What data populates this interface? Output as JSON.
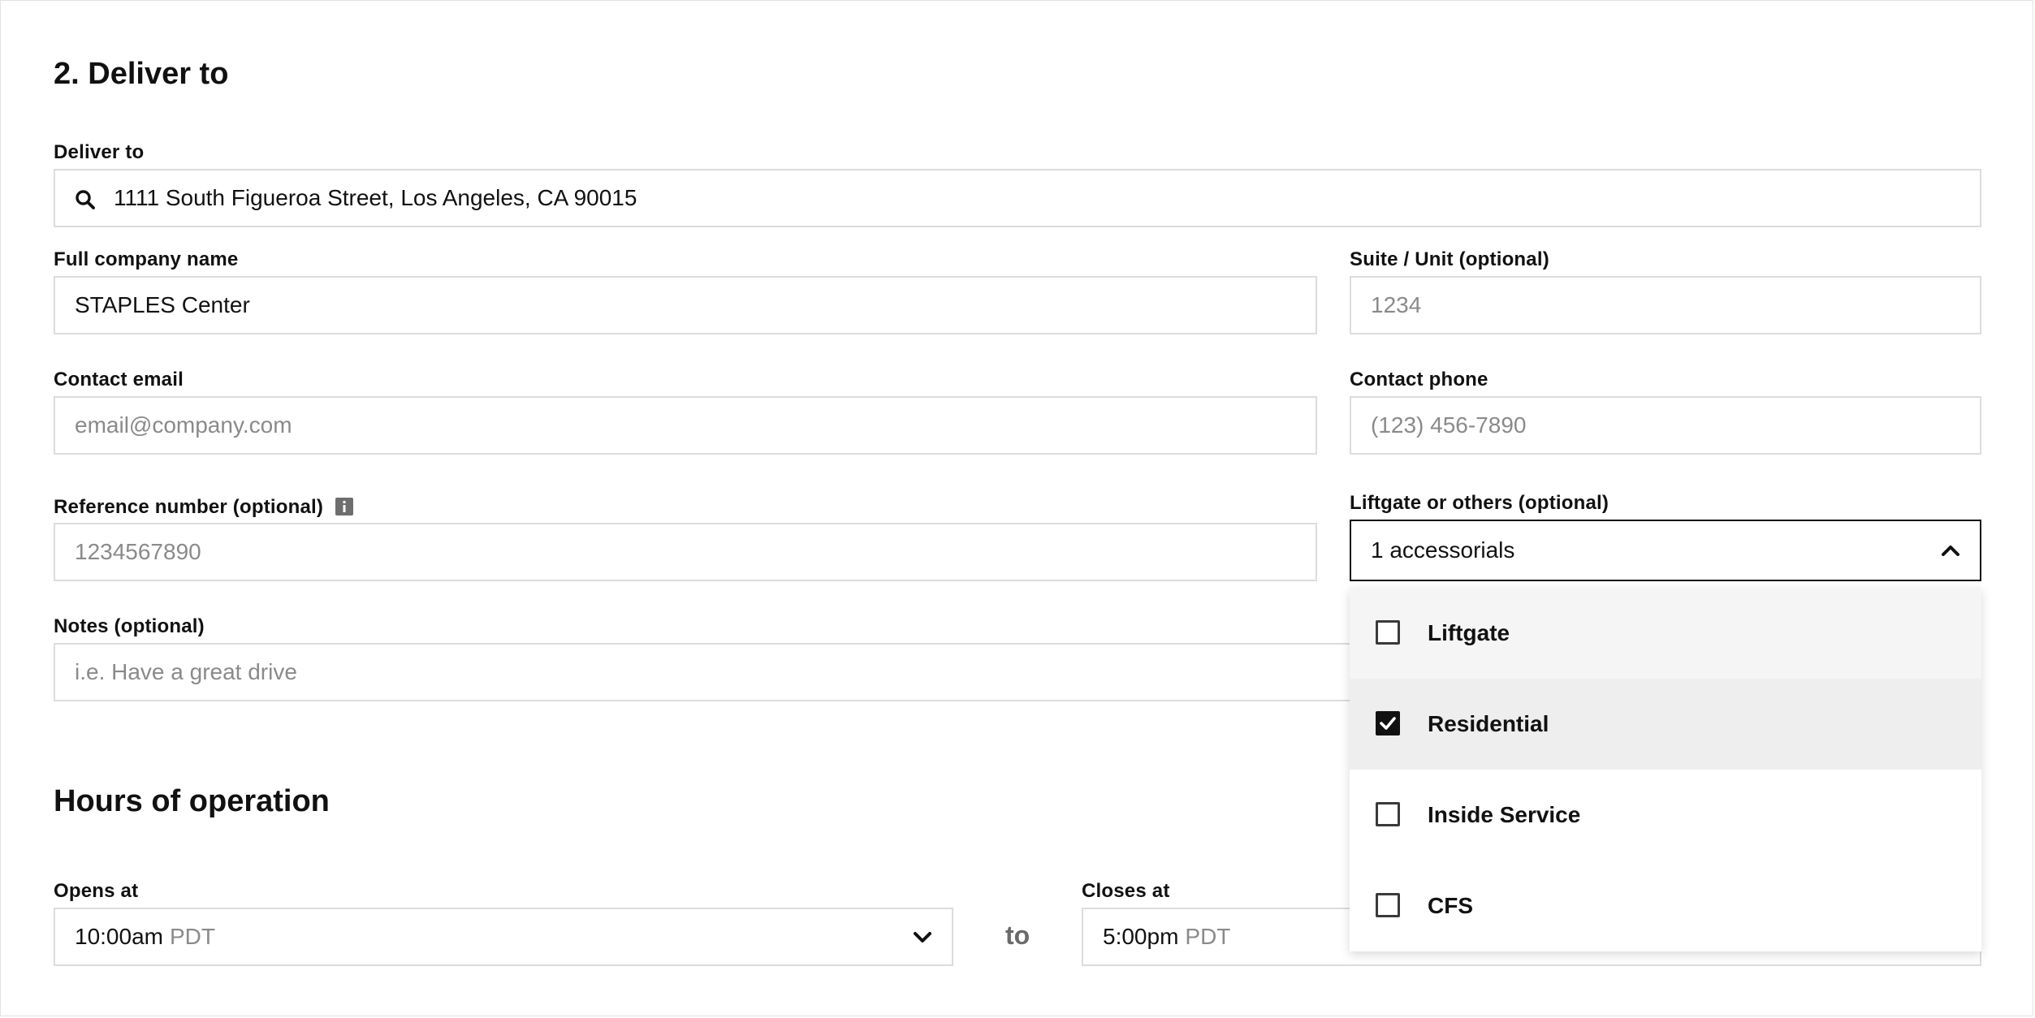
{
  "section": {
    "title": "2. Deliver to"
  },
  "deliver_to": {
    "label": "Deliver to",
    "value": "1111 South Figueroa Street, Los Angeles, CA 90015",
    "icon": "search-icon"
  },
  "company": {
    "label": "Full company name",
    "value": "STAPLES Center"
  },
  "suite": {
    "label": "Suite / Unit (optional)",
    "placeholder": "1234"
  },
  "email": {
    "label": "Contact email",
    "placeholder": "email@company.com"
  },
  "phone": {
    "label": "Contact phone",
    "placeholder": "(123) 456-7890"
  },
  "reference": {
    "label": "Reference number (optional)",
    "placeholder": "1234567890",
    "icon": "info-icon"
  },
  "accessorials": {
    "label": "Liftgate or others (optional)",
    "value": "1 accessorials",
    "icon": "chevron-up-icon",
    "options": [
      {
        "label": "Liftgate",
        "checked": false
      },
      {
        "label": "Residential",
        "checked": true
      },
      {
        "label": "Inside Service",
        "checked": false
      },
      {
        "label": "CFS",
        "checked": false
      }
    ]
  },
  "notes": {
    "label": "Notes (optional)",
    "placeholder": "i.e. Have a great drive"
  },
  "hours": {
    "title": "Hours of operation",
    "opens": {
      "label": "Opens at",
      "value": "10:00am",
      "tz": "PDT",
      "icon": "chevron-down-icon"
    },
    "separator": "to",
    "closes": {
      "label": "Closes at",
      "value": "5:00pm",
      "tz": "PDT"
    }
  },
  "colors": {
    "border": "#dcdcdc",
    "focus_border": "#111111",
    "hover_row": "#f5f5f5",
    "selected_row": "#eeeeee",
    "placeholder": "#8a8a8a"
  }
}
